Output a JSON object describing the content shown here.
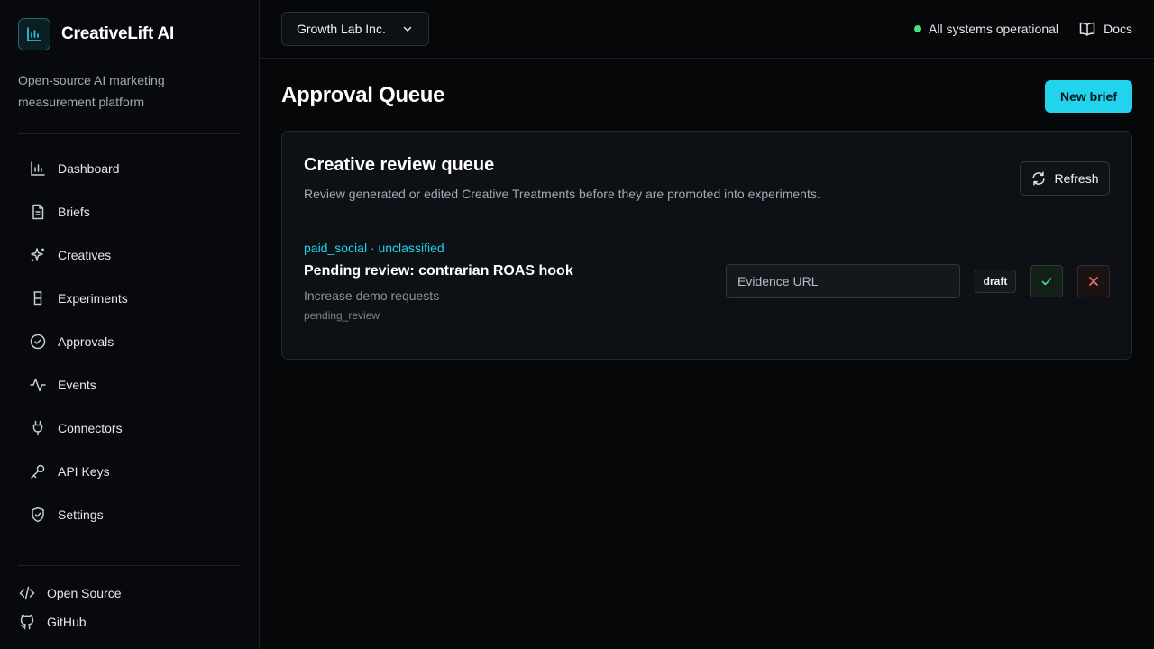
{
  "sidebar": {
    "brand": "CreativeLift AI",
    "tagline": "Open-source AI marketing measurement platform",
    "items": [
      {
        "label": "Dashboard",
        "icon": "bar-chart-icon"
      },
      {
        "label": "Briefs",
        "icon": "file-text-icon"
      },
      {
        "label": "Creatives",
        "icon": "sparkles-icon"
      },
      {
        "label": "Experiments",
        "icon": "beaker-icon"
      },
      {
        "label": "Approvals",
        "icon": "check-circle-icon"
      },
      {
        "label": "Events",
        "icon": "activity-icon"
      },
      {
        "label": "Connectors",
        "icon": "plug-icon"
      },
      {
        "label": "API Keys",
        "icon": "key-icon"
      },
      {
        "label": "Settings",
        "icon": "shield-check-icon"
      }
    ],
    "footer": {
      "open_source": "Open Source",
      "github": "GitHub"
    }
  },
  "topbar": {
    "org": "Growth Lab Inc.",
    "status": "All systems operational",
    "docs": "Docs"
  },
  "main": {
    "title": "Approval Queue",
    "new_brief": "New brief",
    "card": {
      "title": "Creative review queue",
      "description": "Review generated or edited Creative Treatments before they are promoted into experiments.",
      "refresh": "Refresh",
      "item": {
        "meta": "paid_social · unclassified",
        "title": "Pending review: contrarian ROAS hook",
        "goal": "Increase demo requests",
        "status": "pending_review",
        "evidence_placeholder": "Evidence URL",
        "badge": "draft"
      }
    }
  },
  "colors": {
    "accent": "#22d3ee",
    "status_ok": "#4ade80",
    "approve": "#4ade80",
    "reject": "#f87171"
  }
}
